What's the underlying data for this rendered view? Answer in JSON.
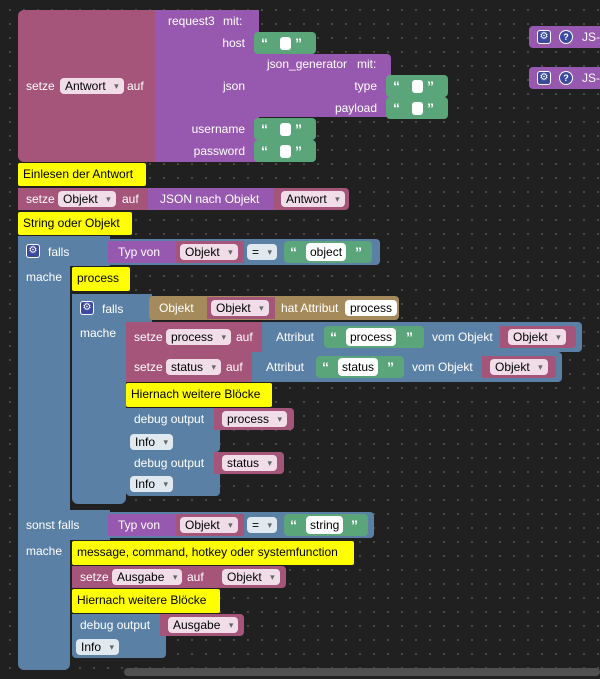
{
  "setze": "setze",
  "auf": "auf",
  "falls": "falls",
  "mache": "mache",
  "sonst_falls": "sonst falls",
  "mit": "mit:",
  "typ_von": "Typ von",
  "vom_objekt": "vom Objekt",
  "attribut": "Attribut",
  "hat_attribut": "hat Attribut",
  "debug_output": "debug output",
  "info": "Info",
  "eq": "=",
  "gear_glyph": "⚙",
  "qmark_glyph": "?",
  "quote_open": "“",
  "quote_close": "”",
  "side_tab_label": "JS-",
  "request": {
    "name": "request3",
    "var": "Antwort",
    "params": [
      "host",
      "json",
      "username",
      "password"
    ]
  },
  "json_gen": {
    "name": "json_generator",
    "params": [
      "type",
      "payload"
    ]
  },
  "comments": {
    "c1": "Einlesen der Antwort",
    "c2": "String oder Objekt",
    "c3": "process",
    "c4": "Hiernach weitere Blöcke",
    "c5": "message, command, hotkey oder systemfunction",
    "c6": "Hiernach weitere Blöcke"
  },
  "json_nach_objekt": "JSON nach Objekt",
  "vars": {
    "objekt": "Objekt",
    "antwort": "Antwort",
    "process": "process",
    "status": "status",
    "ausgabe": "Ausgabe"
  },
  "strings": {
    "object": "object",
    "process": "process",
    "status": "status",
    "string": "string"
  },
  "object_label": "Objekt",
  "attr_value": "process",
  "colors": {
    "variables": "#a5547a",
    "function": "#9758b0",
    "text": "#5ba57a",
    "logic": "#5b80a5",
    "object": "#a58b5b",
    "comment": "#ffff00",
    "workspace": "#202020"
  }
}
